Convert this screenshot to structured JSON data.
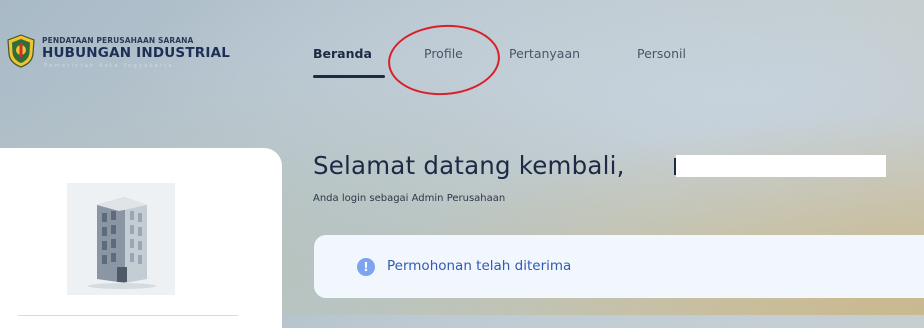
{
  "header": {
    "logo_line1": "PENDATAAN PERUSAHAAN SARANA",
    "logo_line2": "HUBUNGAN INDUSTRIAL",
    "logo_line3": "Pemerintah Kota Yogyakarta",
    "crest_icon": "city-crest-icon"
  },
  "nav": {
    "items": [
      {
        "label": "Beranda",
        "active": true
      },
      {
        "label": "Profile",
        "active": false
      },
      {
        "label": "Pertanyaan",
        "active": false
      },
      {
        "label": "Personil",
        "active": false
      }
    ]
  },
  "main": {
    "welcome": "Selamat datang kembali,",
    "subtitle": "Anda login sebagai Admin Perusahaan",
    "alert_message": "Permohonan telah diterima",
    "alert_icon": "info-icon",
    "alert_icon_glyph": "!"
  },
  "sidebar": {
    "company_image_icon": "building-icon"
  },
  "colors": {
    "primary_text": "#1e2a45",
    "alert_bg": "#f2f6fd",
    "alert_text": "#2f5bb5",
    "annotation": "#d8202a"
  }
}
